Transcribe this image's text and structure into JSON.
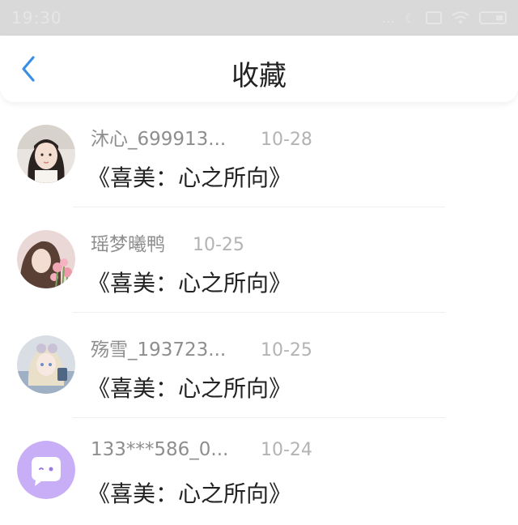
{
  "status_bar": {
    "time": "19:30"
  },
  "header": {
    "title": "收藏",
    "back_icon": "chevron-left-icon",
    "accent_color": "#3a8ee6"
  },
  "items": [
    {
      "username": "沐心_699913...",
      "date": "10-28",
      "book": "《喜美：心之所向》",
      "avatar": "girl-photo-avatar"
    },
    {
      "username": "瑶梦曦鸭",
      "date": "10-25",
      "book": "《喜美：心之所向》",
      "avatar": "girl-tulips-avatar"
    },
    {
      "username": "殇雪_193723...",
      "date": "10-25",
      "book": "《喜美：心之所向》",
      "avatar": "anime-girl-avatar"
    },
    {
      "username": "133***586_0...",
      "date": "10-24",
      "book": "《喜美：心之所向》",
      "avatar": "chat-bubble-avatar"
    }
  ]
}
